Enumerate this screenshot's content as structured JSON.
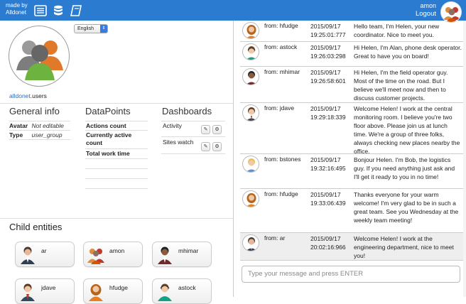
{
  "topbar": {
    "made_by_line1": "made by",
    "made_by_line2": "Alldonet",
    "icons": [
      "list-icon",
      "database-icon",
      "book-icon"
    ],
    "username": "amon",
    "logout_label": "Logout",
    "bg_color": "#2b7bd0"
  },
  "entity": {
    "language": "English",
    "path_link": "alldonet",
    "path_rest": ".users",
    "general_title": "General info",
    "avatar_label": "Avatar",
    "avatar_value": "Not editable",
    "type_label": "Type",
    "type_value": "user_group",
    "datapoints_title": "DataPoints",
    "datapoints": [
      "Actions count",
      "Currently active count",
      "Total work time"
    ],
    "dashboards_title": "Dashboards",
    "dashboards": [
      "Activity",
      "Sites watch"
    ],
    "child_title": "Child entities",
    "children": [
      "ar",
      "amon",
      "mhimar",
      "jdave",
      "hfudge",
      "astock"
    ]
  },
  "chat": {
    "messages": [
      {
        "from": "from: hfudge",
        "date": "2015/09/17",
        "time": "19:25:01:777",
        "text": "Hello team, I'm Helen, your new coordinator. Nice to meet you."
      },
      {
        "from": "from: astock",
        "date": "2015/09/17",
        "time": "19:26:03:298",
        "text": "Hi Helen, I'm Alan, phone desk operator. Great to have you on board!"
      },
      {
        "from": "from: mhimar",
        "date": "2015/09/17",
        "time": "19:26:58:601",
        "text": "Hi Helen, I'm the field operator guy. Most of the time on the road. But I believe we'll meet now and then to discuss customer projects."
      },
      {
        "from": "from: jdave",
        "date": "2015/09/17",
        "time": "19:29:18:339",
        "text": "Welcome Helen! I work at the central monitoring room. I believe you're two floor above. Please join us at lunch time. We're a group of three folks, always checking new places nearby the office."
      },
      {
        "from": "from: bstones",
        "date": "2015/09/17",
        "time": "19:32:16:495",
        "text": "Bonjour Helen. I'm Bob, the logistics guy. If you need anything just ask and I'll get it ready to you in no time!"
      },
      {
        "from": "from: hfudge",
        "date": "2015/09/17",
        "time": "19:33:06:439",
        "text": "Thanks everyone for your warm welcome! I'm very glad to be in such a great team. See you Wednesday at the weekly team meeting!"
      },
      {
        "from": "from: ar",
        "date": "2015/09/17",
        "time": "20:02:16:966",
        "text": "Welcome Helen! I work at the engineering department, nice to meet you!"
      }
    ],
    "input_placeholder": "Type your message and press ENTER"
  }
}
